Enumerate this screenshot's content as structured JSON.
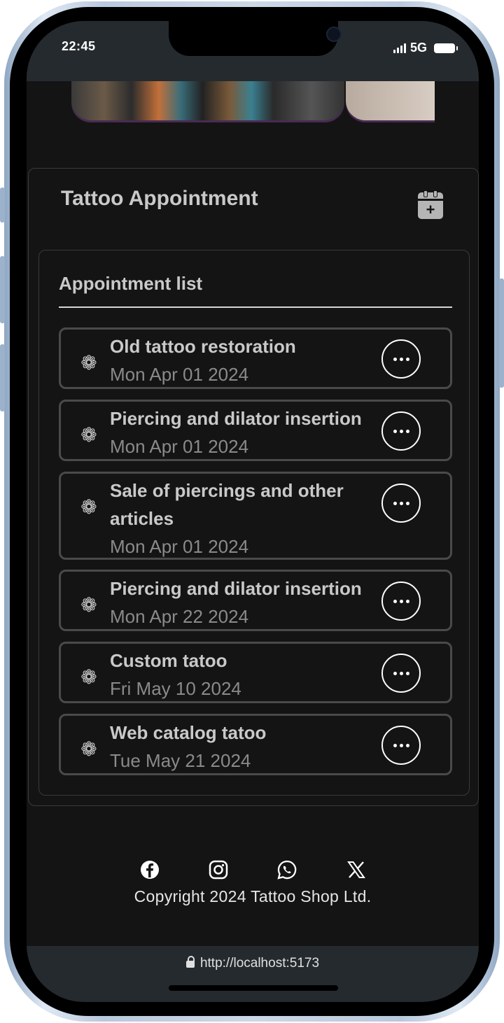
{
  "status": {
    "time": "22:45",
    "network": "5G"
  },
  "card": {
    "title": "Tattoo Appointment",
    "add_icon": "calendar-plus-icon"
  },
  "list": {
    "title": "Appointment list",
    "items": [
      {
        "name": "Old tattoo restoration",
        "date": "Mon Apr 01 2024"
      },
      {
        "name": "Piercing and dilator insertion",
        "date": "Mon Apr 01 2024"
      },
      {
        "name": "Sale of piercings and other articles",
        "date": "Mon Apr 01 2024"
      },
      {
        "name": "Piercing and dilator insertion",
        "date": "Mon Apr 22 2024"
      },
      {
        "name": "Custom tatoo",
        "date": "Fri May 10 2024"
      },
      {
        "name": "Web catalog tatoo",
        "date": "Tue May 21 2024"
      }
    ],
    "item_icon": "flower-icon",
    "action_icon": "more-horizontal-icon"
  },
  "footer": {
    "icons": [
      "facebook-icon",
      "instagram-icon",
      "whatsapp-icon",
      "x-icon"
    ],
    "copyright": "Copyright 2024 Tattoo Shop Ltd."
  },
  "browser": {
    "url": "http://localhost:5173"
  }
}
